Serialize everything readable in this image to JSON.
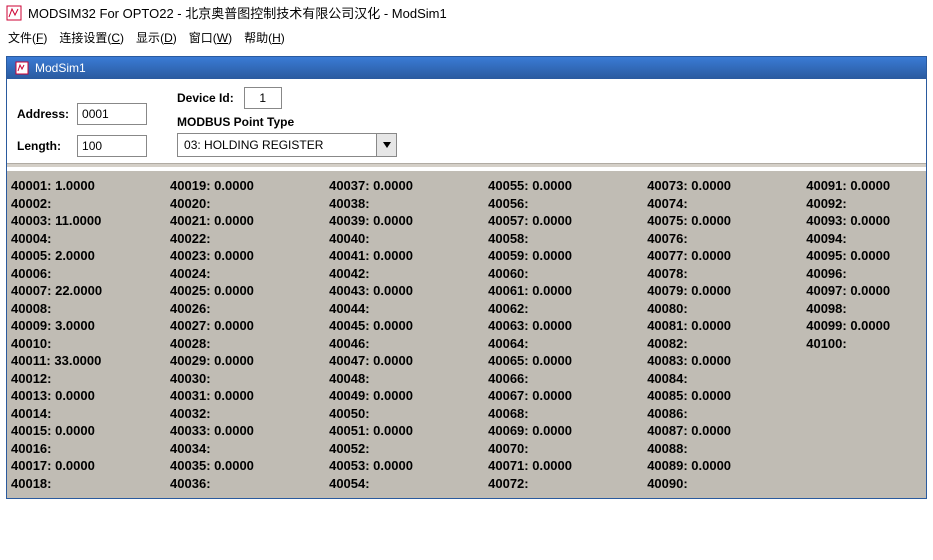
{
  "title": "MODSIM32 For OPTO22 - 北京奥普图控制技术有限公司汉化 - ModSim1",
  "menu": {
    "file": {
      "label": "文件",
      "key": "F"
    },
    "conn": {
      "label": "连接设置",
      "key": "C"
    },
    "disp": {
      "label": "显示",
      "key": "D"
    },
    "wind": {
      "label": "窗口",
      "key": "W"
    },
    "help": {
      "label": "帮助",
      "key": "H"
    }
  },
  "mdi": {
    "title": "ModSim1"
  },
  "config": {
    "address_label": "Address:",
    "address_value": "0001",
    "length_label": "Length:",
    "length_value": "100",
    "device_id_label": "Device Id:",
    "device_id_value": "1",
    "point_type_label": "MODBUS Point Type",
    "point_type_value": "03: HOLDING REGISTER"
  },
  "registers": [
    {
      "addr": "40001",
      "val": "1.0000"
    },
    {
      "addr": "40002",
      "val": ""
    },
    {
      "addr": "40003",
      "val": "11.0000"
    },
    {
      "addr": "40004",
      "val": ""
    },
    {
      "addr": "40005",
      "val": "2.0000"
    },
    {
      "addr": "40006",
      "val": ""
    },
    {
      "addr": "40007",
      "val": "22.0000"
    },
    {
      "addr": "40008",
      "val": ""
    },
    {
      "addr": "40009",
      "val": "3.0000"
    },
    {
      "addr": "40010",
      "val": ""
    },
    {
      "addr": "40011",
      "val": "33.0000"
    },
    {
      "addr": "40012",
      "val": ""
    },
    {
      "addr": "40013",
      "val": "0.0000"
    },
    {
      "addr": "40014",
      "val": ""
    },
    {
      "addr": "40015",
      "val": "0.0000"
    },
    {
      "addr": "40016",
      "val": ""
    },
    {
      "addr": "40017",
      "val": "0.0000"
    },
    {
      "addr": "40018",
      "val": ""
    },
    {
      "addr": "40019",
      "val": "0.0000"
    },
    {
      "addr": "40020",
      "val": ""
    },
    {
      "addr": "40021",
      "val": "0.0000"
    },
    {
      "addr": "40022",
      "val": ""
    },
    {
      "addr": "40023",
      "val": "0.0000"
    },
    {
      "addr": "40024",
      "val": ""
    },
    {
      "addr": "40025",
      "val": "0.0000"
    },
    {
      "addr": "40026",
      "val": ""
    },
    {
      "addr": "40027",
      "val": "0.0000"
    },
    {
      "addr": "40028",
      "val": ""
    },
    {
      "addr": "40029",
      "val": "0.0000"
    },
    {
      "addr": "40030",
      "val": ""
    },
    {
      "addr": "40031",
      "val": "0.0000"
    },
    {
      "addr": "40032",
      "val": ""
    },
    {
      "addr": "40033",
      "val": "0.0000"
    },
    {
      "addr": "40034",
      "val": ""
    },
    {
      "addr": "40035",
      "val": "0.0000"
    },
    {
      "addr": "40036",
      "val": ""
    },
    {
      "addr": "40037",
      "val": "0.0000"
    },
    {
      "addr": "40038",
      "val": ""
    },
    {
      "addr": "40039",
      "val": "0.0000"
    },
    {
      "addr": "40040",
      "val": ""
    },
    {
      "addr": "40041",
      "val": "0.0000"
    },
    {
      "addr": "40042",
      "val": ""
    },
    {
      "addr": "40043",
      "val": "0.0000"
    },
    {
      "addr": "40044",
      "val": ""
    },
    {
      "addr": "40045",
      "val": "0.0000"
    },
    {
      "addr": "40046",
      "val": ""
    },
    {
      "addr": "40047",
      "val": "0.0000"
    },
    {
      "addr": "40048",
      "val": ""
    },
    {
      "addr": "40049",
      "val": "0.0000"
    },
    {
      "addr": "40050",
      "val": ""
    },
    {
      "addr": "40051",
      "val": "0.0000"
    },
    {
      "addr": "40052",
      "val": ""
    },
    {
      "addr": "40053",
      "val": "0.0000"
    },
    {
      "addr": "40054",
      "val": ""
    },
    {
      "addr": "40055",
      "val": "0.0000"
    },
    {
      "addr": "40056",
      "val": ""
    },
    {
      "addr": "40057",
      "val": "0.0000"
    },
    {
      "addr": "40058",
      "val": ""
    },
    {
      "addr": "40059",
      "val": "0.0000"
    },
    {
      "addr": "40060",
      "val": ""
    },
    {
      "addr": "40061",
      "val": "0.0000"
    },
    {
      "addr": "40062",
      "val": ""
    },
    {
      "addr": "40063",
      "val": "0.0000"
    },
    {
      "addr": "40064",
      "val": ""
    },
    {
      "addr": "40065",
      "val": "0.0000"
    },
    {
      "addr": "40066",
      "val": ""
    },
    {
      "addr": "40067",
      "val": "0.0000"
    },
    {
      "addr": "40068",
      "val": ""
    },
    {
      "addr": "40069",
      "val": "0.0000"
    },
    {
      "addr": "40070",
      "val": ""
    },
    {
      "addr": "40071",
      "val": "0.0000"
    },
    {
      "addr": "40072",
      "val": ""
    },
    {
      "addr": "40073",
      "val": "0.0000"
    },
    {
      "addr": "40074",
      "val": ""
    },
    {
      "addr": "40075",
      "val": "0.0000"
    },
    {
      "addr": "40076",
      "val": ""
    },
    {
      "addr": "40077",
      "val": "0.0000"
    },
    {
      "addr": "40078",
      "val": ""
    },
    {
      "addr": "40079",
      "val": "0.0000"
    },
    {
      "addr": "40080",
      "val": ""
    },
    {
      "addr": "40081",
      "val": "0.0000"
    },
    {
      "addr": "40082",
      "val": ""
    },
    {
      "addr": "40083",
      "val": "0.0000"
    },
    {
      "addr": "40084",
      "val": ""
    },
    {
      "addr": "40085",
      "val": "0.0000"
    },
    {
      "addr": "40086",
      "val": ""
    },
    {
      "addr": "40087",
      "val": "0.0000"
    },
    {
      "addr": "40088",
      "val": ""
    },
    {
      "addr": "40089",
      "val": "0.0000"
    },
    {
      "addr": "40090",
      "val": ""
    },
    {
      "addr": "40091",
      "val": "0.0000"
    },
    {
      "addr": "40092",
      "val": ""
    },
    {
      "addr": "40093",
      "val": "0.0000"
    },
    {
      "addr": "40094",
      "val": ""
    },
    {
      "addr": "40095",
      "val": "0.0000"
    },
    {
      "addr": "40096",
      "val": ""
    },
    {
      "addr": "40097",
      "val": "0.0000"
    },
    {
      "addr": "40098",
      "val": ""
    },
    {
      "addr": "40099",
      "val": "0.0000"
    },
    {
      "addr": "40100",
      "val": ""
    }
  ]
}
